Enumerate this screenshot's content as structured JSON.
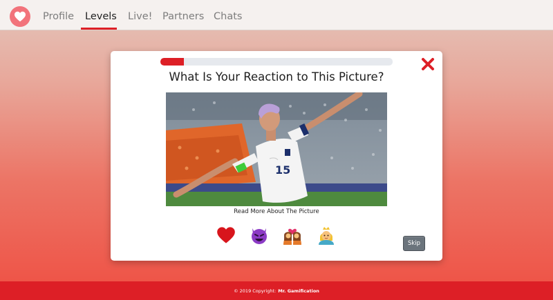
{
  "nav": {
    "logo_icon": "heart-icon",
    "items": [
      {
        "label": "Profile",
        "active": false
      },
      {
        "label": "Levels",
        "active": true
      },
      {
        "label": "Live!",
        "active": false
      },
      {
        "label": "Partners",
        "active": false
      },
      {
        "label": "Chats",
        "active": false
      }
    ]
  },
  "modal": {
    "progress_fraction": 0.1,
    "question": "What Is Your Reaction to This Picture?",
    "close_icon": "close-x-icon",
    "picture_icon": "soccer-player-celebration-photo",
    "read_more": "Read More About The Picture",
    "reactions": [
      {
        "icon": "red-heart-icon"
      },
      {
        "icon": "smiling-devil-icon"
      },
      {
        "icon": "kissing-couple-icon"
      },
      {
        "icon": "princess-icon"
      }
    ],
    "skip_label": "Skip"
  },
  "footer": {
    "copyright": "© 2019 Copyright:",
    "brand": "Mr. Gamification"
  },
  "colors": {
    "accent": "#dd1f26",
    "logo_bg": "#f2737b",
    "nav_bg": "#f5f1ef",
    "skip_bg": "#6b747c"
  }
}
